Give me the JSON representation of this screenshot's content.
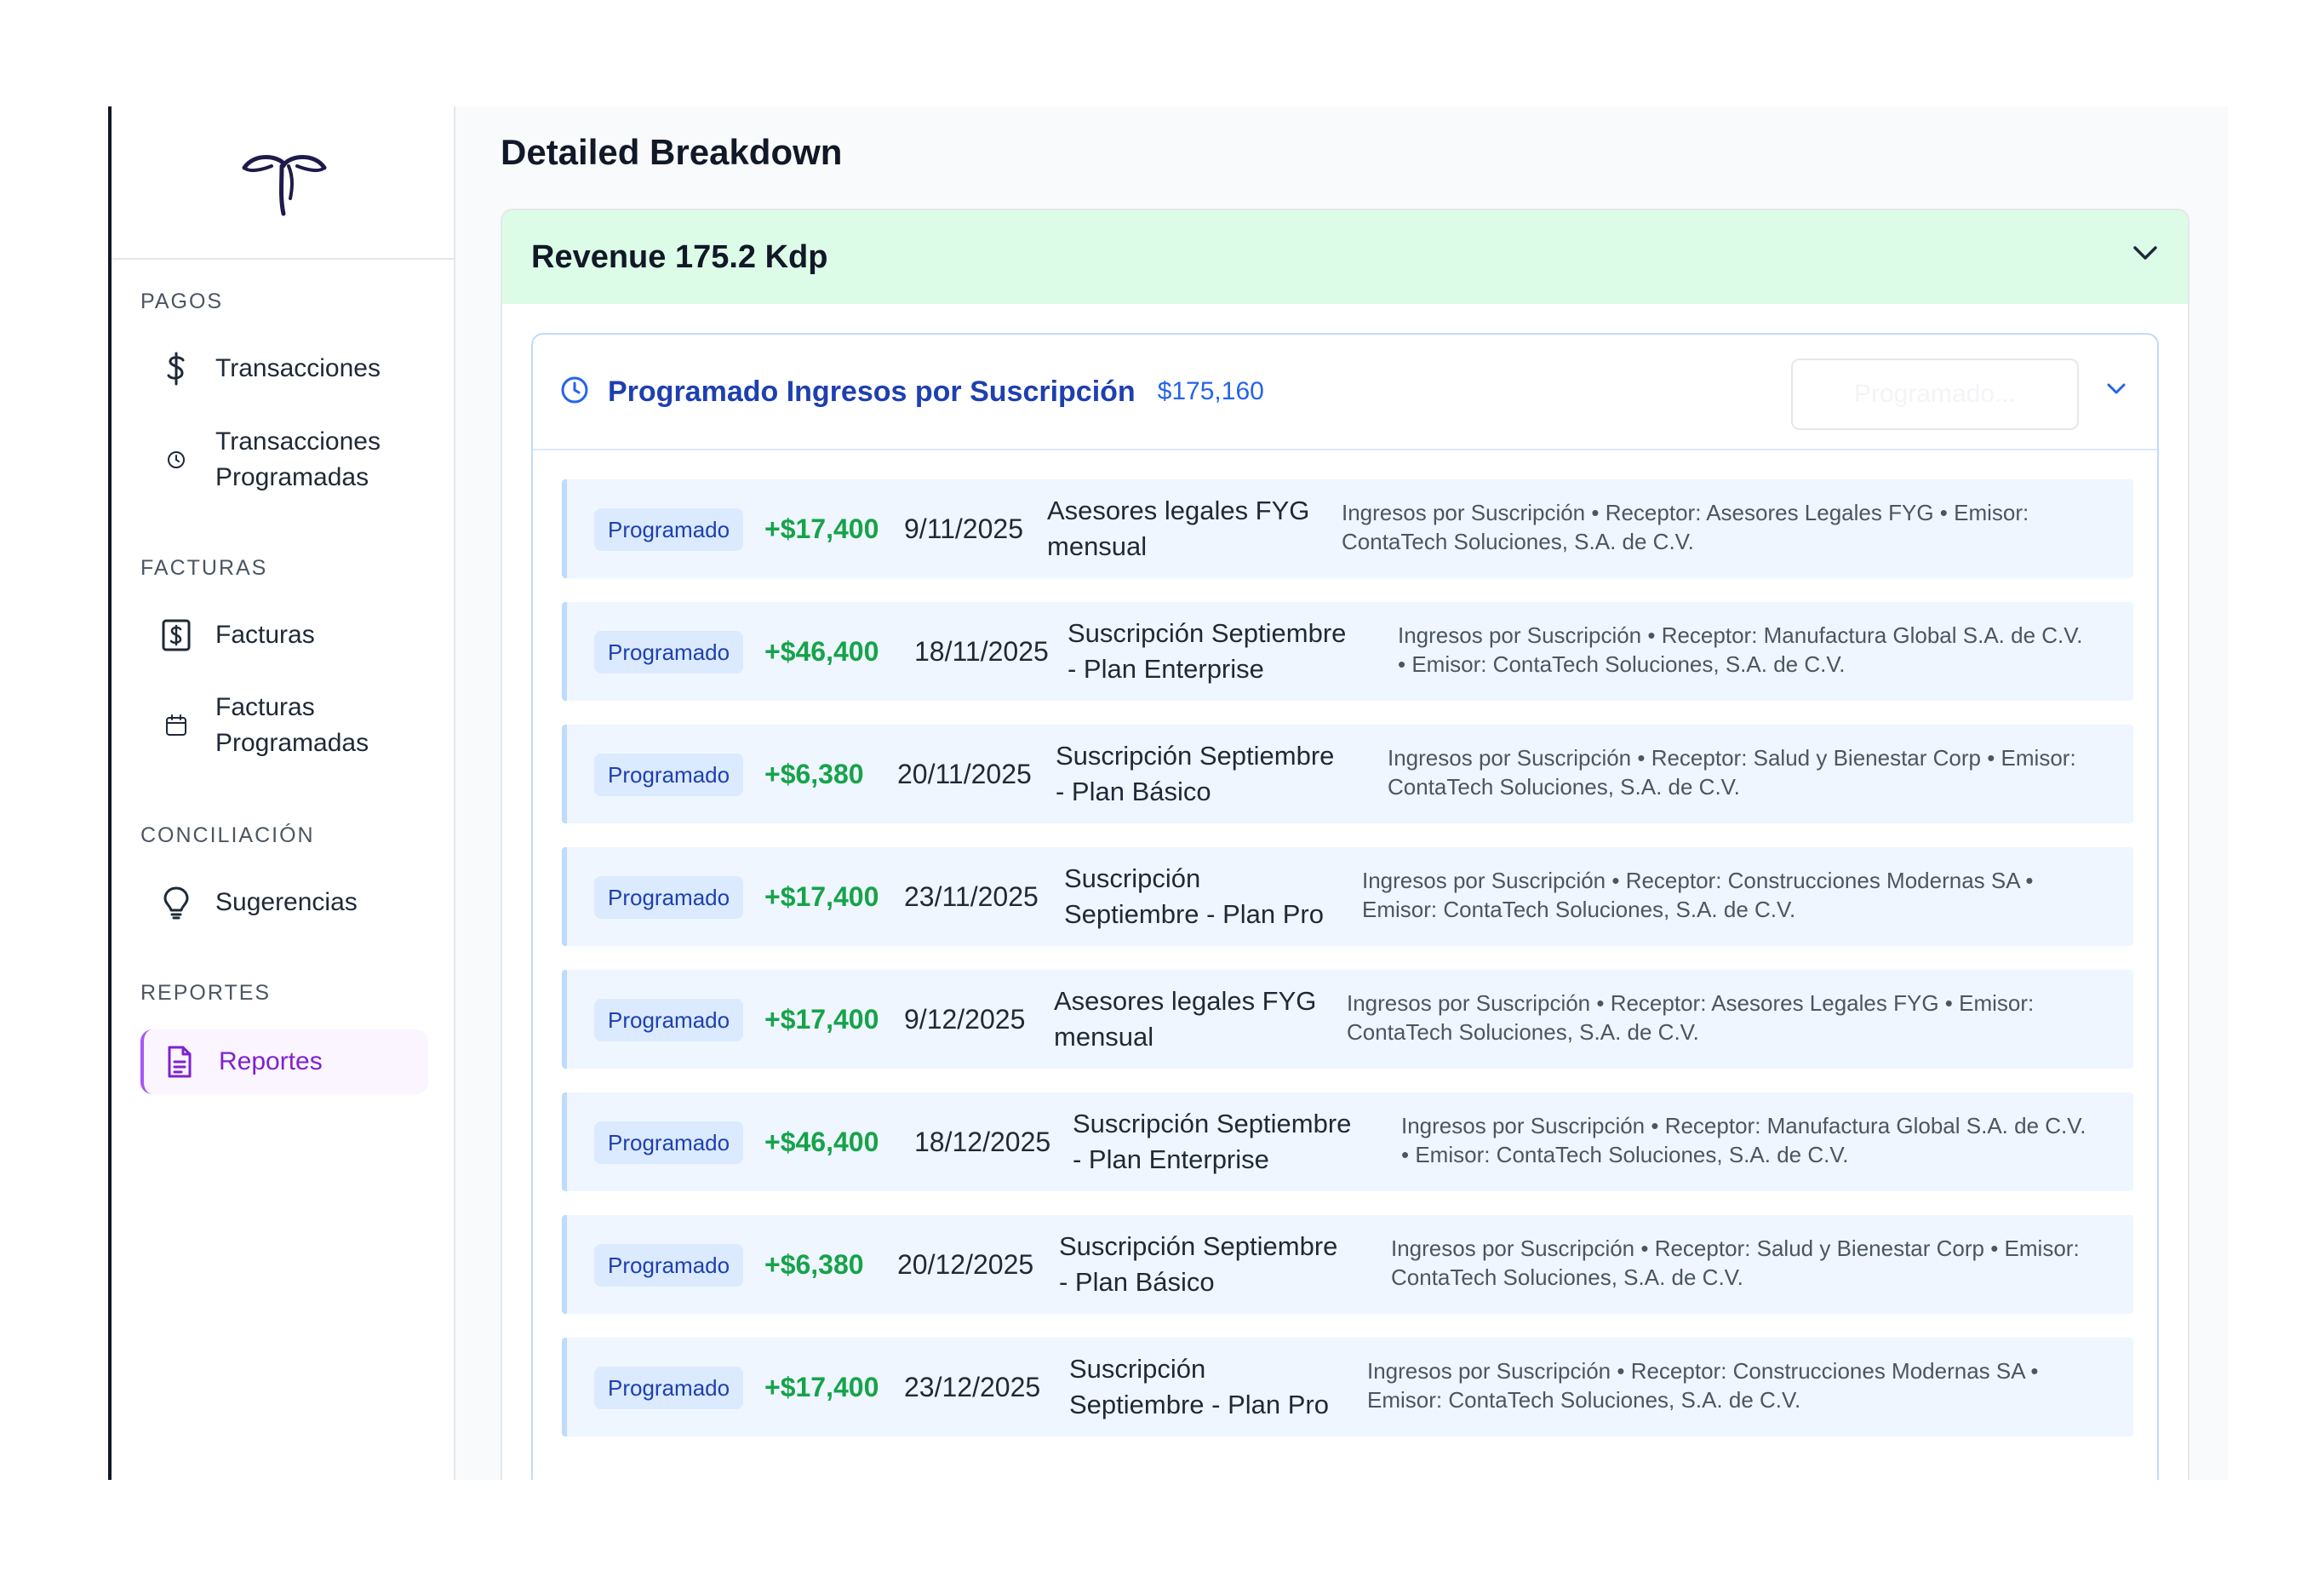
{
  "sidebar": {
    "sections": [
      {
        "title": "PAGOS"
      },
      {
        "title": "FACTURAS"
      },
      {
        "title": "CONCILIACIÓN"
      },
      {
        "title": "REPORTES"
      }
    ],
    "items": [
      {
        "label": "Transacciones",
        "icon": "dollar-icon"
      },
      {
        "label_line1": "Transacciones",
        "label_line2": "Programadas",
        "icon": "clock-icon"
      },
      {
        "label": "Facturas",
        "icon": "invoice-icon"
      },
      {
        "label_line1": "Facturas",
        "label_line2": "Programadas",
        "icon": "calendar-icon"
      },
      {
        "label": "Sugerencias",
        "icon": "lightbulb-icon"
      },
      {
        "label": "Reportes",
        "icon": "document-icon",
        "active": true
      }
    ]
  },
  "main": {
    "title": "Detailed Breakdown",
    "revenue": {
      "title": "Revenue 175.2 Kdp",
      "group": {
        "title": "Programado Ingresos por Suscripción",
        "total": "$175,160",
        "select_placeholder": "Programado...",
        "rows": [
          {
            "badge": "Programado",
            "amount": "+$17,400",
            "date": "9/11/2025",
            "desc1": "Asesores legales FYG",
            "desc2": "mensual",
            "meta1": "Ingresos por Suscripción • Receptor: Asesores Legales FYG • Emisor:",
            "meta2": "ContaTech Soluciones, S.A. de C.V."
          },
          {
            "badge": "Programado",
            "amount": "+$46,400",
            "date": "18/11/2025",
            "desc1": "Suscripción Septiembre",
            "desc2": "- Plan Enterprise",
            "meta1": "Ingresos por Suscripción • Receptor: Manufactura Global S.A. de C.V.",
            "meta2": "• Emisor: ContaTech Soluciones, S.A. de C.V."
          },
          {
            "badge": "Programado",
            "amount": "+$6,380",
            "date": "20/11/2025",
            "desc1": "Suscripción Septiembre",
            "desc2": "- Plan Básico",
            "meta1": "Ingresos por Suscripción • Receptor: Salud y Bienestar Corp • Emisor:",
            "meta2": "ContaTech Soluciones, S.A. de C.V."
          },
          {
            "badge": "Programado",
            "amount": "+$17,400",
            "date": "23/11/2025",
            "desc1": "Suscripción",
            "desc2": "Septiembre - Plan Pro",
            "meta1": "Ingresos por Suscripción • Receptor: Construcciones Modernas SA •",
            "meta2": "Emisor: ContaTech Soluciones, S.A. de C.V."
          },
          {
            "badge": "Programado",
            "amount": "+$17,400",
            "date": "9/12/2025",
            "desc1": "Asesores legales FYG",
            "desc2": "mensual",
            "meta1": "Ingresos por Suscripción • Receptor: Asesores Legales FYG • Emisor:",
            "meta2": "ContaTech Soluciones, S.A. de C.V."
          },
          {
            "badge": "Programado",
            "amount": "+$46,400",
            "date": "18/12/2025",
            "desc1": "Suscripción Septiembre",
            "desc2": "- Plan Enterprise",
            "meta1": "Ingresos por Suscripción • Receptor: Manufactura Global S.A. de C.V.",
            "meta2": "• Emisor: ContaTech Soluciones, S.A. de C.V."
          },
          {
            "badge": "Programado",
            "amount": "+$6,380",
            "date": "20/12/2025",
            "desc1": "Suscripción Septiembre",
            "desc2": "- Plan Básico",
            "meta1": "Ingresos por Suscripción • Receptor: Salud y Bienestar Corp • Emisor:",
            "meta2": "ContaTech Soluciones, S.A. de C.V."
          },
          {
            "badge": "Programado",
            "amount": "+$17,400",
            "date": "23/12/2025",
            "desc1": "Suscripción",
            "desc2": "Septiembre - Plan Pro",
            "meta1": "Ingresos por Suscripción • Receptor: Construcciones Modernas SA •",
            "meta2": "Emisor: ContaTech Soluciones, S.A. de C.V."
          }
        ]
      }
    }
  },
  "colors": {
    "accent_purple": "#7e22ce",
    "revenue_header_bg": "#dcfce7",
    "group_title": "#1e40af",
    "amount_green": "#16a34a",
    "row_bg": "#eff6ff"
  }
}
